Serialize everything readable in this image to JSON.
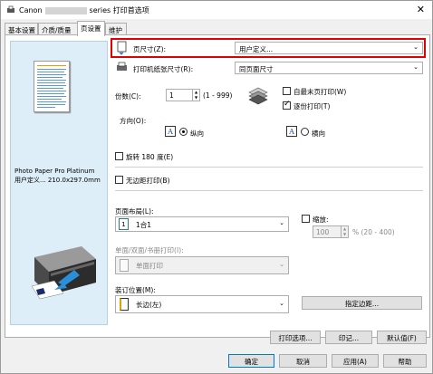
{
  "window": {
    "title_prefix": "Canon",
    "title_suffix": "series 打印首选项",
    "close_glyph": "✕"
  },
  "tabs": [
    {
      "label": "基本设置"
    },
    {
      "label": "介质/质量"
    },
    {
      "label": "页设置"
    },
    {
      "label": "维护"
    }
  ],
  "left_panel": {
    "media_name": "Photo Paper Pro Platinum",
    "media_size": "用户定义... 210.0x297.0mm"
  },
  "page_setup": {
    "page_size_label": "页尺寸(Z):",
    "page_size_value": "用户定义...",
    "printer_paper_label": "打印机纸张尺寸(R):",
    "printer_paper_value": "同页面尺寸",
    "copies_label": "份数(C):",
    "copies_value": "1",
    "copies_range": "(1 - 999)",
    "reverse_order_label": "自最末页打印(W)",
    "reverse_order_checked": false,
    "collate_label": "逐份打印(T)",
    "collate_checked": true,
    "orientation_label": "方向(O):",
    "portrait_label": "纵向",
    "landscape_label": "横向",
    "portrait_icon_glyph": "A",
    "landscape_icon_glyph": "A",
    "orientation_selected": "portrait",
    "rotate_label": "旋转 180 度(E)",
    "rotate_checked": false,
    "borderless_label": "无边距打印(B)",
    "borderless_checked": false,
    "page_layout_label": "页面布局(L):",
    "page_layout_value": "1合1",
    "page_layout_icon_glyph": "1",
    "scaling_label": "缩放:",
    "scaling_checked": false,
    "scaling_value": "100",
    "scaling_range": "% (20 - 400)",
    "duplex_label": "单面/双面/书册打印(I):",
    "duplex_value": "单面打印",
    "stapling_label": "装订位置(M):",
    "stapling_value": "长边(左)",
    "specify_margin_label": "指定边距..."
  },
  "bottom_buttons": {
    "print_options": "打印选项...",
    "stamp": "印记...",
    "defaults": "默认值(F)"
  },
  "dialog_buttons": {
    "ok": "确定",
    "cancel": "取消",
    "apply": "应用(A)",
    "help": "帮助"
  },
  "colors": {
    "highlight_border": "#e00000",
    "left_panel_bg": "#ddeef8",
    "default_button_border": "#0078d7"
  }
}
